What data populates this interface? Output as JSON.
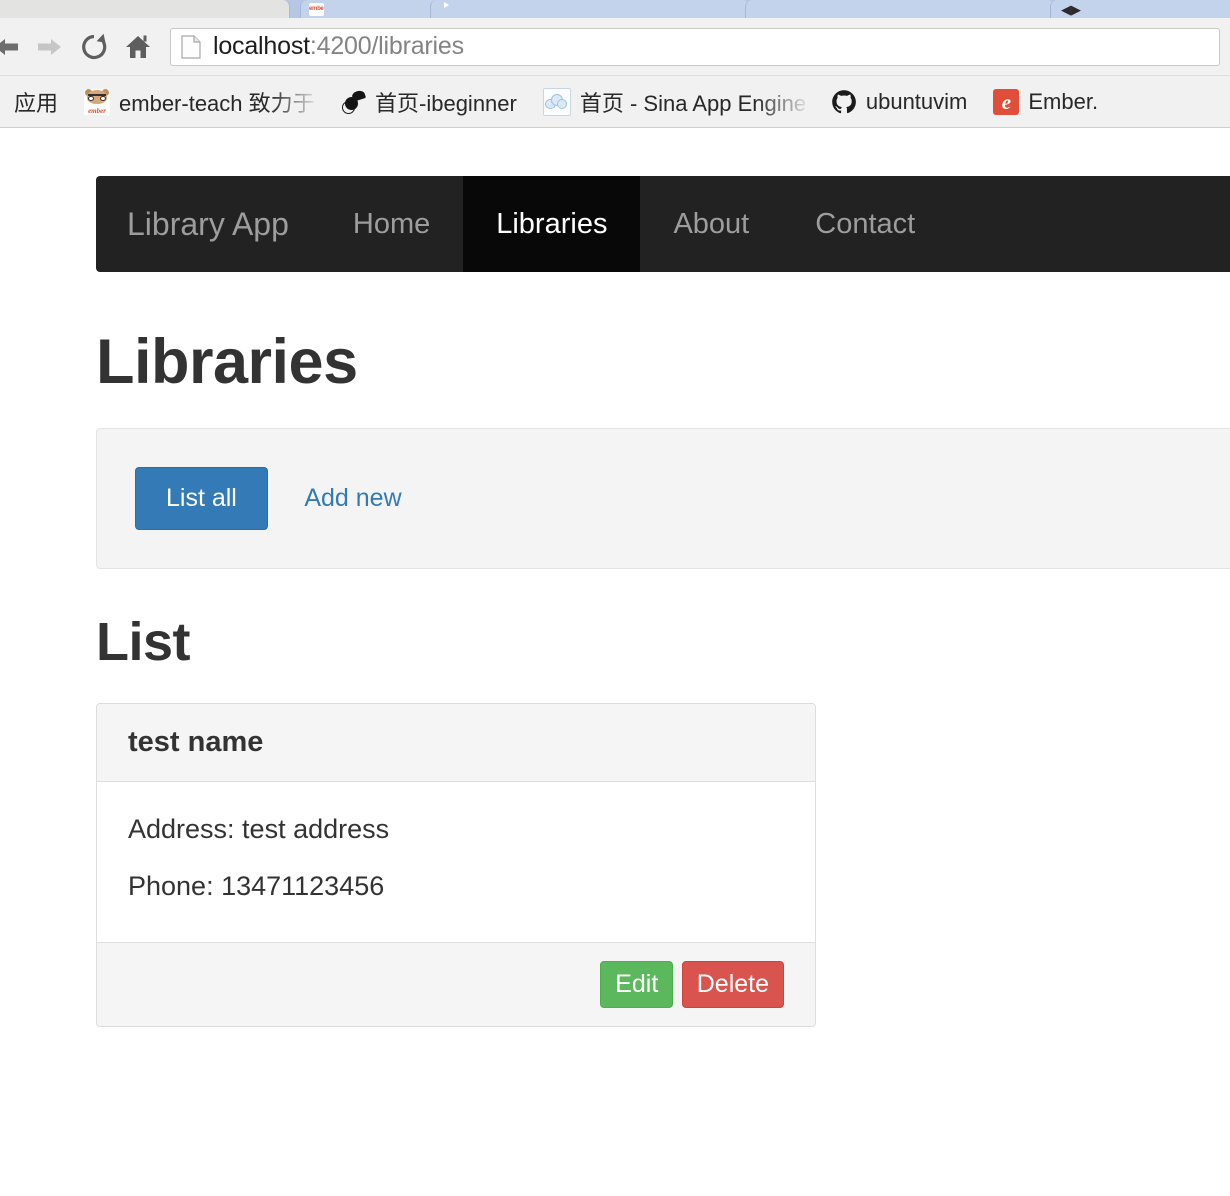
{
  "browser": {
    "toolbar": {
      "back_icon": "back-arrow-icon",
      "forward_icon": "forward-arrow-icon",
      "reload_icon": "reload-icon",
      "home_icon": "home-icon",
      "page_icon": "page-document-icon",
      "url_host": "localhost",
      "url_rest": ":4200/libraries",
      "url_full": "localhost:4200/libraries"
    },
    "tabs": [
      {
        "name": "active-tab",
        "favicon": "none",
        "state": "active"
      },
      {
        "name": "ember-tab",
        "favicon": "ember-icon",
        "state": "inactive"
      },
      {
        "name": "video-tab",
        "favicon": "youtube-icon",
        "state": "inactive"
      },
      {
        "name": "plain-tab",
        "favicon": "none",
        "state": "inactive"
      },
      {
        "name": "glyph-tab",
        "favicon": "arrows-glyph",
        "state": "inactive"
      }
    ],
    "bookmarks": [
      {
        "label": "应用",
        "icon": "apps-icon",
        "faded": false
      },
      {
        "label": "ember-teach 致力于打",
        "icon": "ember-teach-icon",
        "faded": true
      },
      {
        "label": "首页-ibeginner",
        "icon": "bird-icon",
        "faded": false
      },
      {
        "label": "首页 - Sina App Engine",
        "icon": "cloud-icon",
        "faded": true
      },
      {
        "label": "ubuntuvim",
        "icon": "github-icon",
        "faded": false
      },
      {
        "label": "Ember.",
        "icon": "ember-e-icon",
        "faded": false
      }
    ]
  },
  "page": {
    "navbar": {
      "brand": "Library App",
      "items": [
        {
          "label": "Home",
          "active": false
        },
        {
          "label": "Libraries",
          "active": true
        },
        {
          "label": "About",
          "active": false
        },
        {
          "label": "Contact",
          "active": false
        }
      ]
    },
    "page_title": "Libraries",
    "actions": {
      "list_all_label": "List all",
      "add_new_label": "Add new"
    },
    "list_section": {
      "heading": "List",
      "cards": [
        {
          "name": "test name",
          "address_label": "Address:",
          "address_value": "test address",
          "address_line": "Address: test address",
          "phone_label": "Phone:",
          "phone_value": "13471123456",
          "phone_line": "Phone: 13471123456",
          "edit_label": "Edit",
          "delete_label": "Delete"
        }
      ]
    }
  },
  "colors": {
    "navbar_bg": "#222222",
    "navbar_active_bg": "#080808",
    "primary": "#337ab7",
    "success": "#5cb85c",
    "danger": "#d9534f",
    "well_bg": "#f4f4f4",
    "panel_head_bg": "#f5f5f5",
    "text": "#333333"
  }
}
